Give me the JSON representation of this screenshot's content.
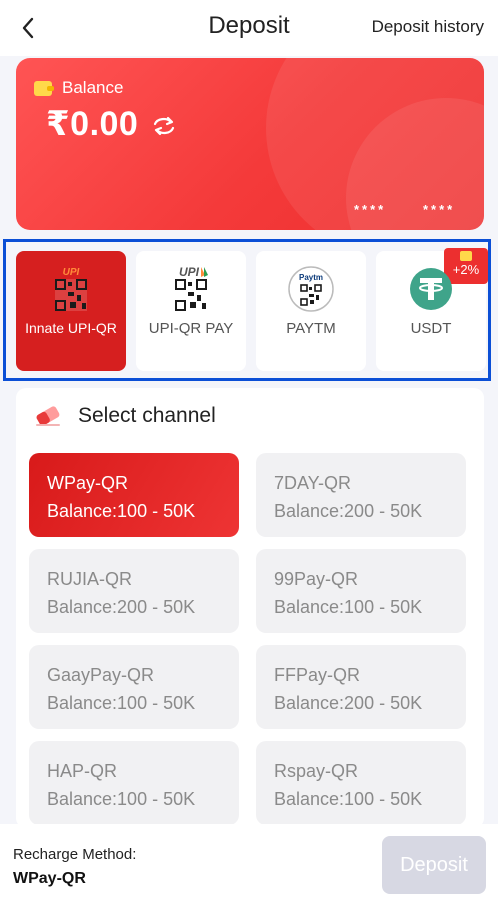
{
  "header": {
    "title": "Deposit",
    "history_link": "Deposit history",
    "back_icon": "chevron-left-icon"
  },
  "balance_card": {
    "label": "Balance",
    "amount": "₹0.00",
    "mask_left": "****",
    "mask_right": "****",
    "color": "#f43a3a"
  },
  "payment_methods": [
    {
      "label": "Innate UPI-QR",
      "icon": "upi-qr-icon",
      "active": true
    },
    {
      "label": "UPI-QR PAY",
      "icon": "upi-qr-icon",
      "active": false
    },
    {
      "label": "PAYTM",
      "icon": "paytm-qr-icon",
      "active": false
    },
    {
      "label": "USDT",
      "icon": "tether-icon",
      "active": false,
      "badge": "+2%"
    }
  ],
  "channel_section": {
    "title": "Select channel",
    "channels": [
      {
        "name": "WPay-QR",
        "range": "Balance:100 - 50K",
        "active": true
      },
      {
        "name": "7DAY-QR",
        "range": "Balance:200 - 50K",
        "active": false
      },
      {
        "name": "RUJIA-QR",
        "range": "Balance:200 - 50K",
        "active": false
      },
      {
        "name": "99Pay-QR",
        "range": "Balance:100 - 50K",
        "active": false
      },
      {
        "name": "GaayPay-QR",
        "range": "Balance:100 - 50K",
        "active": false
      },
      {
        "name": "FFPay-QR",
        "range": "Balance:200 - 50K",
        "active": false
      },
      {
        "name": "HAP-QR",
        "range": "Balance:100 - 50K",
        "active": false
      },
      {
        "name": "Rspay-QR",
        "range": "Balance:100 - 50K",
        "active": false
      }
    ]
  },
  "footer": {
    "method_label": "Recharge Method:",
    "method_value": "WPay-QR",
    "deposit_button": "Deposit"
  },
  "colors": {
    "accent_red": "#d61f1f",
    "highlight_border": "#0b4fd6",
    "disabled_button": "#d7d8e3"
  }
}
